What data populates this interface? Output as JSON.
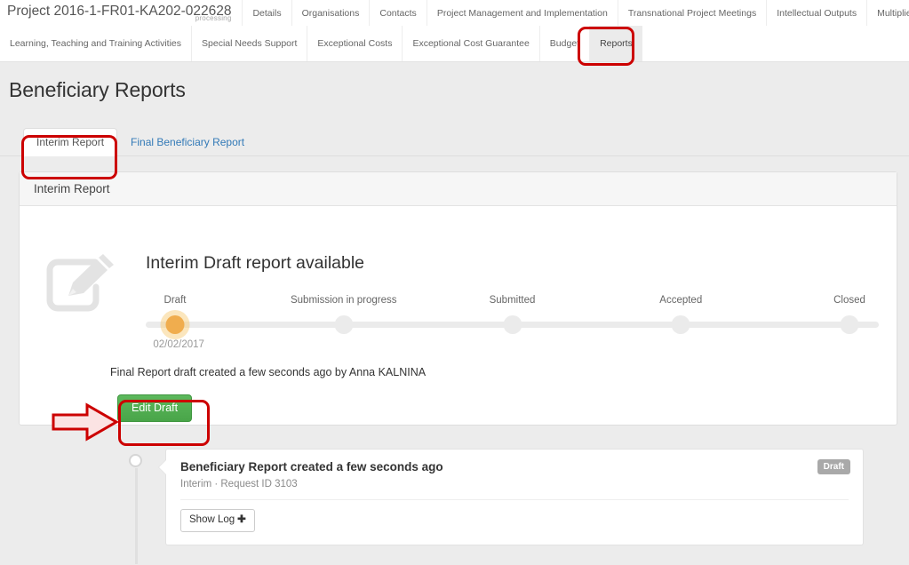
{
  "topnav": {
    "project_title": "Project 2016-1-FR01-KA202-022628",
    "project_status": "processing",
    "row1": [
      {
        "label": "Details",
        "active": false
      },
      {
        "label": "Organisations",
        "active": false
      },
      {
        "label": "Contacts",
        "active": false
      },
      {
        "label": "Project Management and Implementation",
        "active": false
      },
      {
        "label": "Transnational Project Meetings",
        "active": false
      },
      {
        "label": "Intellectual Outputs",
        "active": false
      },
      {
        "label": "Multiplier Events",
        "active": false
      }
    ],
    "row2": [
      {
        "label": "Learning, Teaching and Training Activities",
        "active": false
      },
      {
        "label": "Special Needs Support",
        "active": false
      },
      {
        "label": "Exceptional Costs",
        "active": false
      },
      {
        "label": "Exceptional Cost Guarantee",
        "active": false
      },
      {
        "label": "Budget",
        "active": false
      },
      {
        "label": "Reports",
        "active": true
      }
    ]
  },
  "page": {
    "title": "Beneficiary Reports"
  },
  "report_tabs": [
    {
      "label": "Interim Report",
      "active": true
    },
    {
      "label": "Final Beneficiary Report",
      "active": false
    }
  ],
  "panel": {
    "header": "Interim Report",
    "status_heading": "Interim Draft report available",
    "edit_icon": "edit-pencil-square-icon",
    "created_note": "Final Report draft created a few seconds ago by Anna KALNINA",
    "edit_draft_label": "Edit Draft"
  },
  "stepper": {
    "steps": [
      {
        "label": "Draft",
        "state": "done",
        "date": "02/02/2017"
      },
      {
        "label": "Submission in progress",
        "state": "pending",
        "date": ""
      },
      {
        "label": "Submitted",
        "state": "pending",
        "date": ""
      },
      {
        "label": "Accepted",
        "state": "pending",
        "date": ""
      },
      {
        "label": "Closed",
        "state": "pending",
        "date": ""
      }
    ]
  },
  "timeline": [
    {
      "title": "Beneficiary Report created a few seconds ago",
      "subtitle": "Interim · Request ID 3103",
      "badge": "Draft",
      "show_log_label": "Show Log",
      "show_log_plus": "➕"
    }
  ],
  "colors": {
    "annotation_red": "#cc0000",
    "active_step_orange": "#f0ad4e",
    "primary_green": "#5cb85c",
    "link_blue": "#337ab7",
    "badge_gray": "#a9a9a9",
    "page_background": "#ececec"
  }
}
